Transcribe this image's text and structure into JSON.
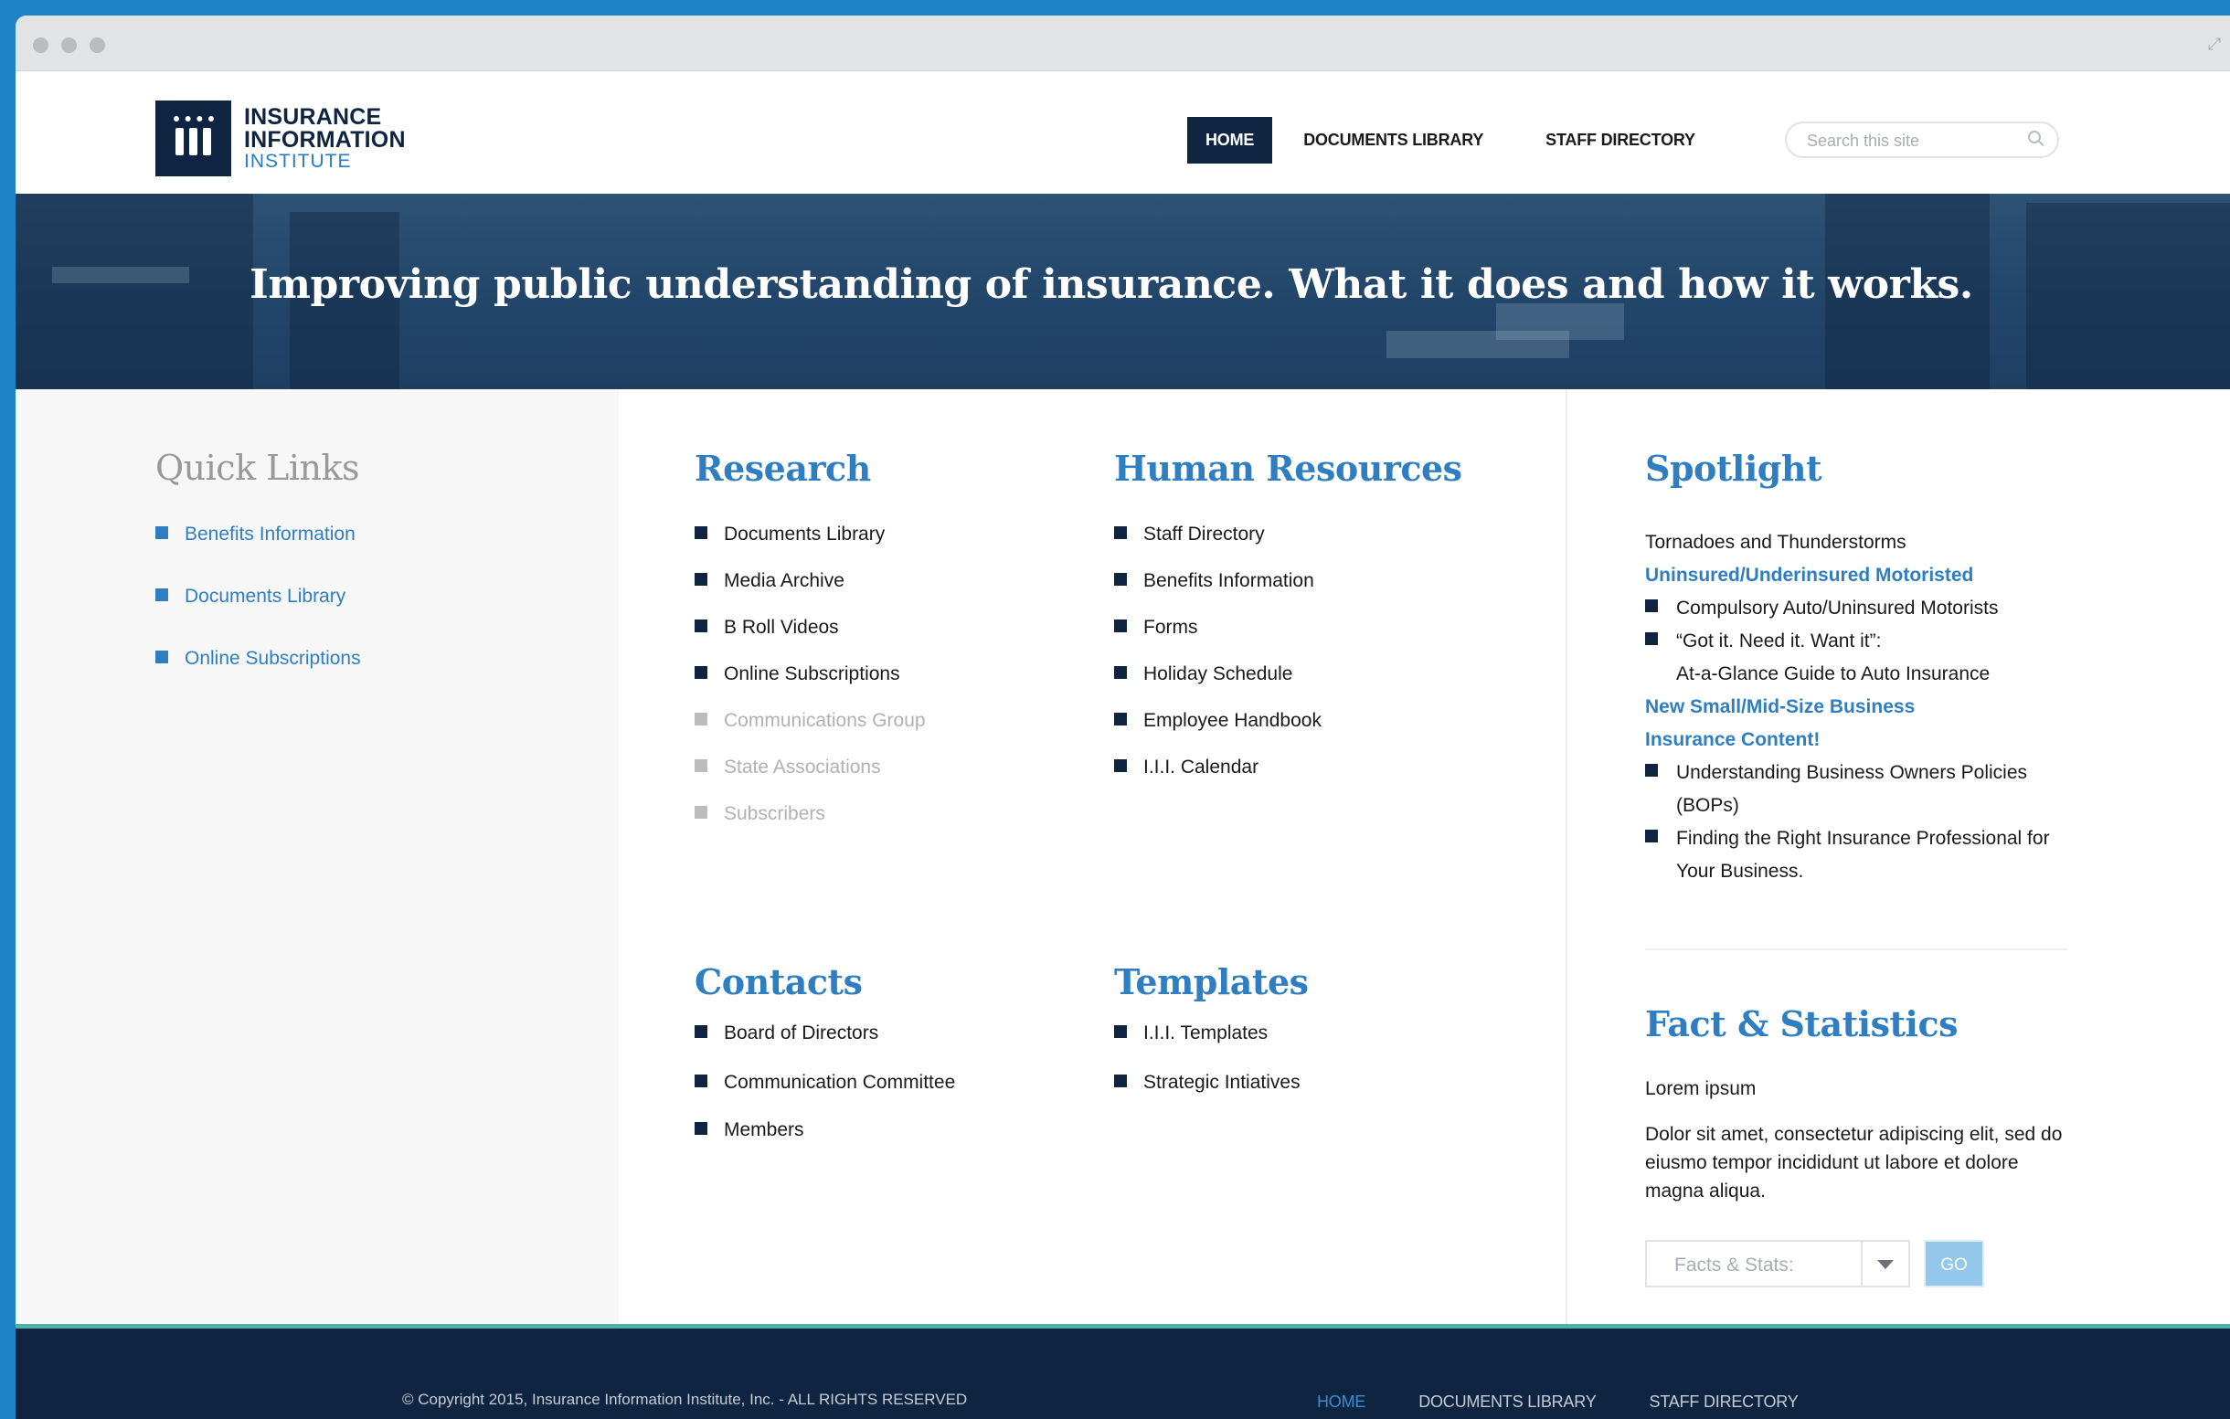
{
  "colors": {
    "brand_navy": "#0f2440",
    "accent_blue": "#2f7ec1",
    "frame_blue": "#1e83c5",
    "footer_teal": "#4cb0ab"
  },
  "logo": {
    "line1": "INSURANCE",
    "line2": "INFORMATION",
    "line3": "INSTITUTE"
  },
  "nav": {
    "home": "HOME",
    "documents": "DOCUMENTS LIBRARY",
    "staff": "STAFF DIRECTORY"
  },
  "search": {
    "placeholder": "Search this site"
  },
  "hero": {
    "tagline": "Improving public understanding of insurance. What it does and how it works."
  },
  "quick_links": {
    "title": "Quick Links",
    "items": [
      "Benefits Information",
      "Documents Library",
      "Online Subscriptions"
    ]
  },
  "research": {
    "title": "Research",
    "items": [
      "Documents Library",
      "Media Archive",
      "B Roll Videos",
      "Online Subscriptions",
      "Communications Group",
      "State Associations",
      "Subscribers"
    ]
  },
  "human_resources": {
    "title": "Human Resources",
    "items": [
      "Staff Directory",
      "Benefits Information",
      "Forms",
      "Holiday Schedule",
      "Employee Handbook",
      "I.I.I. Calendar"
    ]
  },
  "contacts": {
    "title": "Contacts",
    "items": [
      "Board of Directors",
      "Communication Committee",
      "Members"
    ]
  },
  "templates": {
    "title": "Templates",
    "items": [
      "I.I.I. Templates",
      "Strategic Intiatives"
    ]
  },
  "spotlight": {
    "title": "Spotlight",
    "intro": "Tornadoes and Thunderstorms",
    "link1": "Uninsured/Underinsured Motoristed",
    "item1": "Compulsory Auto/Uninsured Motorists",
    "item2_l1": "“Got it. Need it. Want it”:",
    "item2_l2": "At-a-Glance Guide to Auto Insurance",
    "link2_l1": "New Small/Mid-Size Business",
    "link2_l2": "Insurance Content!",
    "item3": "Understanding Business Owners Policies (BOPs)",
    "item4": "Finding the Right Insurance Professional for Your Business."
  },
  "facts": {
    "title": "Fact & Statistics",
    "subtitle": "Lorem ipsum",
    "body": "Dolor sit amet, consectetur adipiscing elit, sed do eiusmo tempor incididunt ut labore et dolore magna aliqua.",
    "select_value": "Facts & Stats:",
    "go_label": "GO"
  },
  "footer": {
    "copyright": "© Copyright 2015, Insurance Information Institute, Inc. - ALL RIGHTS RESERVED",
    "home": "HOME",
    "documents": "DOCUMENTS LIBRARY",
    "staff": "STAFF DIRECTORY"
  }
}
